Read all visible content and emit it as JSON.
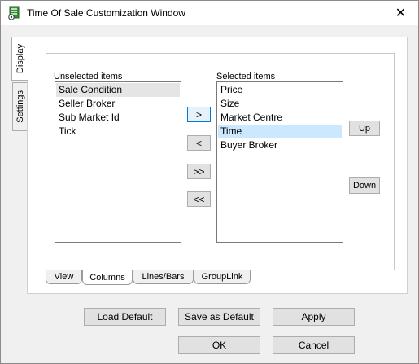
{
  "window": {
    "title": "Time Of Sale Customization Window",
    "close_glyph": "✕"
  },
  "side_tabs": [
    {
      "label": "Display",
      "active": true
    },
    {
      "label": "Settings",
      "active": false
    }
  ],
  "unselected": {
    "label": "Unselected items",
    "items": [
      "Sale Condition",
      "Seller Broker",
      "Sub Market Id",
      "Tick"
    ],
    "highlighted_index": 0
  },
  "selected": {
    "label": "Selected items",
    "items": [
      "Price",
      "Size",
      "Market Centre",
      "Time",
      "Buyer Broker"
    ],
    "highlighted_index": 3
  },
  "move_buttons": {
    "add": ">",
    "remove": "<",
    "add_all": ">>",
    "remove_all": "<<"
  },
  "order_buttons": {
    "up": "Up",
    "down": "Down"
  },
  "bottom_tabs": [
    {
      "label": "View",
      "active": false
    },
    {
      "label": "Columns",
      "active": true
    },
    {
      "label": "Lines/Bars",
      "active": false
    },
    {
      "label": "GroupLink",
      "active": false
    }
  ],
  "footer": {
    "load_default": "Load Default",
    "save_default": "Save as Default",
    "apply": "Apply",
    "ok": "OK",
    "cancel": "Cancel"
  }
}
